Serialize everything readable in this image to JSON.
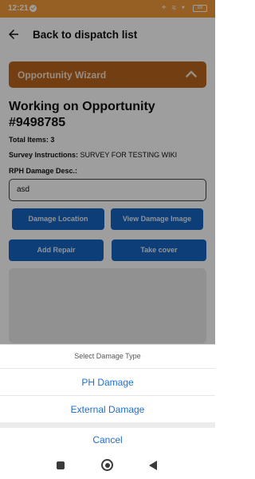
{
  "status_bar": {
    "time": "12:21",
    "system_icons": "⌖ ≋ ▾",
    "battery": "88"
  },
  "header": {
    "title": "Back to dispatch list"
  },
  "wizard": {
    "title": "Opportunity Wizard"
  },
  "opportunity": {
    "title": "Working on Opportunity #9498785",
    "total_items_label": "Total Items:",
    "total_items_value": "3",
    "survey_label": "Survey Instructions:",
    "survey_value": "SURVEY FOR TESTING WIKI",
    "damage_desc_label": "RPH Damage Desc.:",
    "damage_desc_value": "asd"
  },
  "buttons": {
    "damage_location": "Damage Location",
    "view_damage_image": "View Damage Image",
    "add_repair": "Add Repair",
    "take_cover": "Take cover"
  },
  "action_sheet": {
    "title": "Select Damage Type",
    "options": [
      "PH Damage",
      "External Damage"
    ],
    "cancel": "Cancel"
  },
  "colors": {
    "status_bar": "#f29a3a",
    "wizard_bg": "#b8651e",
    "button_blue": "#1565c0",
    "sheet_text_blue": "#1e6fd0"
  }
}
